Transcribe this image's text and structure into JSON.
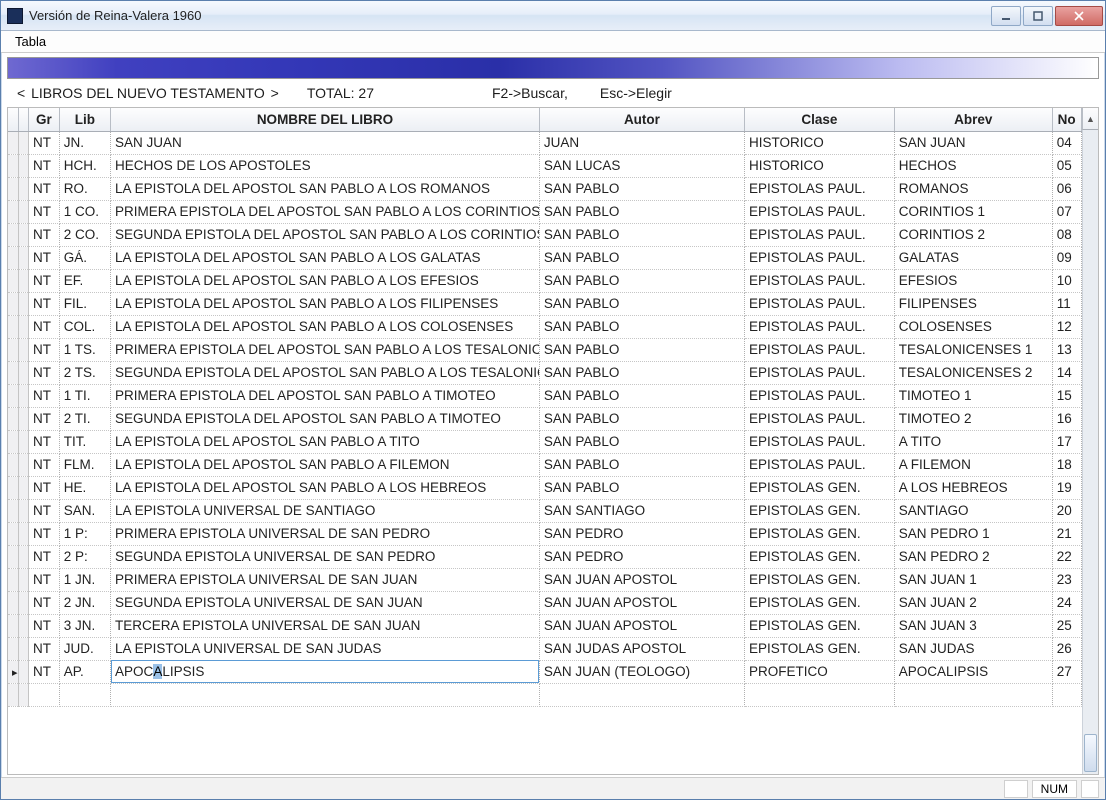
{
  "window": {
    "title": "Versión de Reina-Valera 1960"
  },
  "menu": {
    "tabla": "Tabla"
  },
  "header": {
    "nav_lt": "<",
    "section": "LIBROS DEL NUEVO TESTAMENTO",
    "nav_gt": ">",
    "total_label": "TOTAL: 27",
    "hint_f2": "F2->Buscar,",
    "hint_esc": "Esc->Elegir"
  },
  "columns": {
    "gr": "Gr",
    "lib": "Lib",
    "nombre": "NOMBRE DEL LIBRO",
    "autor": "Autor",
    "clase": "Clase",
    "abrev": "Abrev",
    "no": "No"
  },
  "status": {
    "num": "NUM"
  },
  "selected_index": 23,
  "rows": [
    {
      "gr": "NT",
      "lib": "JN.",
      "nombre": "SAN JUAN",
      "autor": "JUAN",
      "clase": "HISTORICO",
      "abrev": "SAN JUAN",
      "no": "04"
    },
    {
      "gr": "NT",
      "lib": "HCH.",
      "nombre": "HECHOS DE LOS APOSTOLES",
      "autor": "SAN LUCAS",
      "clase": "HISTORICO",
      "abrev": "HECHOS",
      "no": "05"
    },
    {
      "gr": "NT",
      "lib": "RO.",
      "nombre": "LA EPISTOLA DEL APOSTOL SAN PABLO A LOS ROMANOS",
      "autor": "SAN PABLO",
      "clase": "EPISTOLAS PAUL.",
      "abrev": "ROMANOS",
      "no": "06"
    },
    {
      "gr": "NT",
      "lib": "1 CO.",
      "nombre": "PRIMERA EPISTOLA DEL APOSTOL SAN PABLO A LOS CORINTIOS",
      "autor": "SAN PABLO",
      "clase": "EPISTOLAS PAUL.",
      "abrev": "CORINTIOS 1",
      "no": "07"
    },
    {
      "gr": "NT",
      "lib": "2 CO.",
      "nombre": "SEGUNDA EPISTOLA DEL APOSTOL SAN PABLO A LOS CORINTIOS",
      "autor": "SAN PABLO",
      "clase": "EPISTOLAS PAUL.",
      "abrev": "CORINTIOS 2",
      "no": "08"
    },
    {
      "gr": "NT",
      "lib": "GÁ.",
      "nombre": "LA EPISTOLA DEL APOSTOL SAN PABLO A LOS GALATAS",
      "autor": "SAN PABLO",
      "clase": "EPISTOLAS PAUL.",
      "abrev": "GALATAS",
      "no": "09"
    },
    {
      "gr": "NT",
      "lib": "EF.",
      "nombre": "LA EPISTOLA DEL APOSTOL SAN PABLO A LOS EFESIOS",
      "autor": "SAN PABLO",
      "clase": "EPISTOLAS PAUL.",
      "abrev": "EFESIOS",
      "no": "10"
    },
    {
      "gr": "NT",
      "lib": "FIL.",
      "nombre": "LA EPISTOLA DEL APOSTOL SAN PABLO A LOS FILIPENSES",
      "autor": "SAN PABLO",
      "clase": "EPISTOLAS PAUL.",
      "abrev": "FILIPENSES",
      "no": "11"
    },
    {
      "gr": "NT",
      "lib": "COL.",
      "nombre": "LA EPISTOLA DEL APOSTOL SAN PABLO A LOS COLOSENSES",
      "autor": "SAN PABLO",
      "clase": "EPISTOLAS PAUL.",
      "abrev": "COLOSENSES",
      "no": "12"
    },
    {
      "gr": "NT",
      "lib": "1 TS.",
      "nombre": "PRIMERA EPISTOLA DEL APOSTOL SAN PABLO A LOS TESALONICENSES",
      "autor": "SAN PABLO",
      "clase": "EPISTOLAS PAUL.",
      "abrev": "TESALONICENSES 1",
      "no": "13"
    },
    {
      "gr": "NT",
      "lib": "2 TS.",
      "nombre": "SEGUNDA EPISTOLA DEL APOSTOL SAN PABLO A LOS TESALONICENSES",
      "autor": "SAN PABLO",
      "clase": "EPISTOLAS PAUL.",
      "abrev": "TESALONICENSES 2",
      "no": "14"
    },
    {
      "gr": "NT",
      "lib": "1 TI.",
      "nombre": "PRIMERA EPISTOLA DEL APOSTOL SAN PABLO A TIMOTEO",
      "autor": "SAN PABLO",
      "clase": "EPISTOLAS PAUL.",
      "abrev": "TIMOTEO 1",
      "no": "15"
    },
    {
      "gr": "NT",
      "lib": "2 TI.",
      "nombre": "SEGUNDA EPISTOLA DEL APOSTOL SAN PABLO A  TIMOTEO",
      "autor": "SAN PABLO",
      "clase": "EPISTOLAS PAUL.",
      "abrev": "TIMOTEO 2",
      "no": "16"
    },
    {
      "gr": "NT",
      "lib": "TIT.",
      "nombre": "LA EPISTOLA DEL APOSTOL SAN PABLO A TITO",
      "autor": "SAN PABLO",
      "clase": "EPISTOLAS PAUL.",
      "abrev": "A TITO",
      "no": "17"
    },
    {
      "gr": "NT",
      "lib": "FLM.",
      "nombre": "LA EPISTOLA DEL APOSTOL SAN PABLO A FILEMON",
      "autor": "SAN PABLO",
      "clase": "EPISTOLAS PAUL.",
      "abrev": "A FILEMON",
      "no": "18"
    },
    {
      "gr": "NT",
      "lib": "HE.",
      "nombre": "LA EPISTOLA DEL APOSTOL SAN PABLO A LOS HEBREOS",
      "autor": "SAN PABLO",
      "clase": "EPISTOLAS GEN.",
      "abrev": "A LOS HEBREOS",
      "no": "19"
    },
    {
      "gr": "NT",
      "lib": "SAN.",
      "nombre": "LA EPISTOLA UNIVERSAL DE SANTIAGO",
      "autor": "SAN SANTIAGO",
      "clase": "EPISTOLAS GEN.",
      "abrev": "SANTIAGO",
      "no": "20"
    },
    {
      "gr": "NT",
      "lib": "1 P:",
      "nombre": "PRIMERA EPISTOLA UNIVERSAL DE SAN PEDRO",
      "autor": "SAN PEDRO",
      "clase": "EPISTOLAS GEN.",
      "abrev": "SAN PEDRO 1",
      "no": "21"
    },
    {
      "gr": "NT",
      "lib": "2 P:",
      "nombre": "SEGUNDA EPISTOLA UNIVERSAL DE SAN PEDRO",
      "autor": "SAN PEDRO",
      "clase": "EPISTOLAS GEN.",
      "abrev": "SAN PEDRO 2",
      "no": "22"
    },
    {
      "gr": "NT",
      "lib": "1 JN.",
      "nombre": "PRIMERA EPISTOLA UNIVERSAL DE SAN JUAN",
      "autor": "SAN JUAN APOSTOL",
      "clase": "EPISTOLAS GEN.",
      "abrev": "SAN JUAN 1",
      "no": "23"
    },
    {
      "gr": "NT",
      "lib": "2 JN.",
      "nombre": "SEGUNDA EPISTOLA UNIVERSAL DE  SAN JUAN",
      "autor": "SAN JUAN APOSTOL",
      "clase": "EPISTOLAS GEN.",
      "abrev": "SAN JUAN 2",
      "no": "24"
    },
    {
      "gr": "NT",
      "lib": "3 JN.",
      "nombre": "TERCERA EPISTOLA UNIVERSAL DE  SAN JUAN",
      "autor": "SAN JUAN APOSTOL",
      "clase": "EPISTOLAS GEN.",
      "abrev": "SAN JUAN 3",
      "no": "25"
    },
    {
      "gr": "NT",
      "lib": "JUD.",
      "nombre": "LA EPISTOLA UNIVERSAL DE  SAN JUDAS",
      "autor": "SAN JUDAS APOSTOL",
      "clase": "EPISTOLAS GEN.",
      "abrev": "SAN JUDAS",
      "no": "26"
    },
    {
      "gr": "NT",
      "lib": "AP.",
      "nombre": "APOCALIPSIS",
      "autor": "SAN JUAN (TEOLOGO)",
      "clase": "PROFETICO",
      "abrev": "APOCALIPSIS",
      "no": "27"
    }
  ]
}
